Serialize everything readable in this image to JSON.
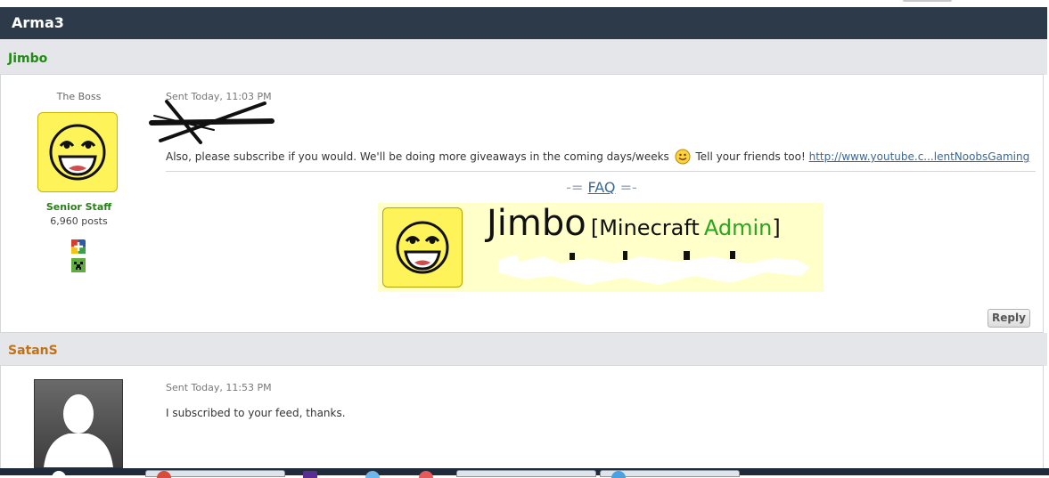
{
  "forum": {
    "title": "Arma3"
  },
  "posts": [
    {
      "author": "Jimbo",
      "author_color": "#218b15",
      "rank_title": "The Boss",
      "group": "Senior Staff",
      "post_count": "6,960 posts",
      "sent": "Sent Today, 11:03 PM",
      "message_line": "Also, please subscribe if you would. We'll be doing more giveaways in the coming days/weeks",
      "message_tail": "Tell your friends too!",
      "link_text": "http://www.youtube.c...lentNoobsGaming",
      "signature": {
        "faq_left": "-=",
        "faq_link": "FAQ",
        "faq_right": "=-",
        "banner_name": "Jimbo",
        "banner_open": "[",
        "banner_role_a": "Minecraft",
        "banner_role_b": "Admin",
        "banner_close": "]"
      },
      "reply_label": "Reply"
    },
    {
      "author": "SatanS",
      "author_color": "#c07316",
      "sent": "Sent Today, 11:53 PM",
      "message": "I subscribed to your feed, thanks."
    }
  ],
  "icons": [
    "smiley-face-icon",
    "plus-badge-icon",
    "creeper-badge-icon",
    "default-avatar-icon",
    "awesome-face-icon"
  ],
  "colors": {
    "titlebar": "#2c3a4a",
    "link": "#39689a",
    "avatar_yellow": "#fff35a",
    "banner_green": "#2aa61e"
  }
}
